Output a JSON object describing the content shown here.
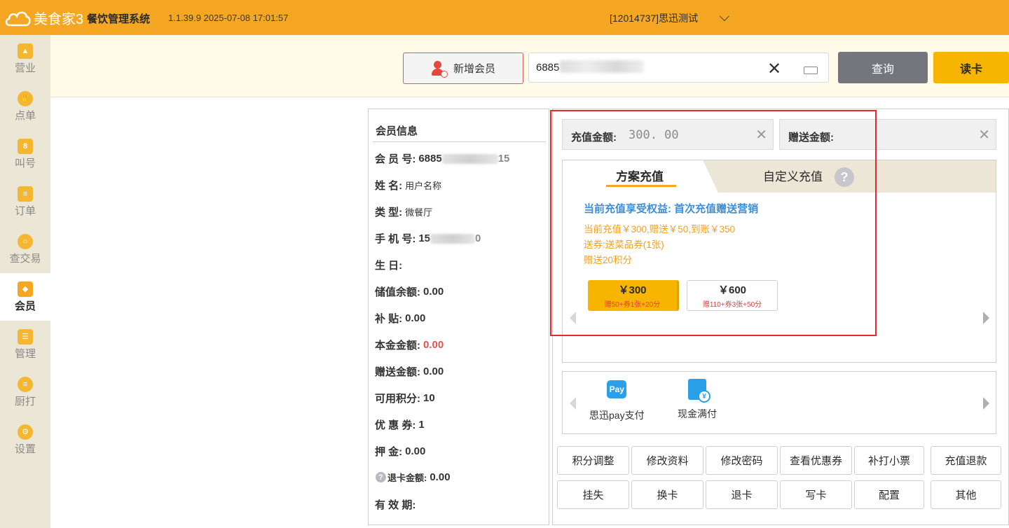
{
  "app": {
    "logo_text": "美食家3",
    "system_name": "餐饮管理系统",
    "version": "1.1.39.9 2025-07-08 17:01:57",
    "store": "[12014737]思迅测试"
  },
  "sidebar": {
    "items": [
      {
        "label": "营业",
        "icon": "chart-icon"
      },
      {
        "label": "点单",
        "icon": "hand-icon"
      },
      {
        "label": "叫号",
        "icon": "number-icon"
      },
      {
        "label": "订单",
        "icon": "list-icon"
      },
      {
        "label": "查交易",
        "icon": "search-icon"
      },
      {
        "label": "会员",
        "icon": "diamond-icon",
        "active": true
      },
      {
        "label": "管理",
        "icon": "checklist-icon"
      },
      {
        "label": "厨打",
        "icon": "menu-icon"
      },
      {
        "label": "设置",
        "icon": "gear-icon"
      }
    ]
  },
  "search": {
    "add_member_label": "新增会员",
    "value": "6885",
    "query_label": "查询",
    "read_card_label": "读卡"
  },
  "member": {
    "title": "会员信息",
    "rows": [
      {
        "label": "会 员 号:",
        "value": "6885",
        "suffix": "15"
      },
      {
        "label": "姓      名:",
        "value": "用户名称"
      },
      {
        "label": "类      型:",
        "value": "微餐厅"
      },
      {
        "label": "手 机 号:",
        "value": "15",
        "suffix": "0"
      },
      {
        "label": "生      日:",
        "value": ""
      },
      {
        "label": "储值余额:",
        "value": "0.00"
      },
      {
        "label": "补      贴:",
        "value": "0.00"
      },
      {
        "label": "本金金额:",
        "value": "0.00"
      },
      {
        "label": "赠送金额:",
        "value": "0.00"
      },
      {
        "label": "可用积分:",
        "value": "10"
      },
      {
        "label": "优 惠 券:",
        "value": "1"
      },
      {
        "label": "押      金:",
        "value": "0.00"
      },
      {
        "label": "退卡金额:",
        "value": "0.00"
      },
      {
        "label": "有 效 期:",
        "value": ""
      }
    ]
  },
  "recharge": {
    "amount_label": "充值金额:",
    "amount_value": "300. 00",
    "gift_label": "赠送金额:",
    "gift_value": "",
    "tab_plan": "方案充值",
    "tab_custom": "自定义充值",
    "help": "?",
    "benefit_title": "当前充值享受权益:  首次充值赠送营销",
    "benefit_lines": [
      "当前充值￥300,赠送￥50,到账￥350",
      "送券:送菜品券(1张)",
      "赠送20积分"
    ],
    "packages": [
      {
        "price": "￥300",
        "desc": "赠50+券1张+20分",
        "selected": true
      },
      {
        "price": "￥600",
        "desc": "赠110+券3张+50分",
        "selected": false
      }
    ]
  },
  "payment": {
    "methods": [
      {
        "label": "思迅pay支付",
        "icon_text": "Pay"
      },
      {
        "label": "现金满付",
        "icon_text": "¥"
      }
    ]
  },
  "actions": {
    "row1": [
      "积分调整",
      "修改资料",
      "修改密码",
      "查看优惠券",
      "补打小票",
      "充值退款"
    ],
    "row2": [
      "挂失",
      "换卡",
      "退卡",
      "写卡",
      "配置",
      "其他"
    ]
  },
  "colors": {
    "brand": "#f5a623",
    "sidebar_bg": "#ece6d6",
    "highlight": "#e22b2b",
    "link_blue": "#3d8ed8",
    "pay_blue": "#2aa0e8"
  }
}
